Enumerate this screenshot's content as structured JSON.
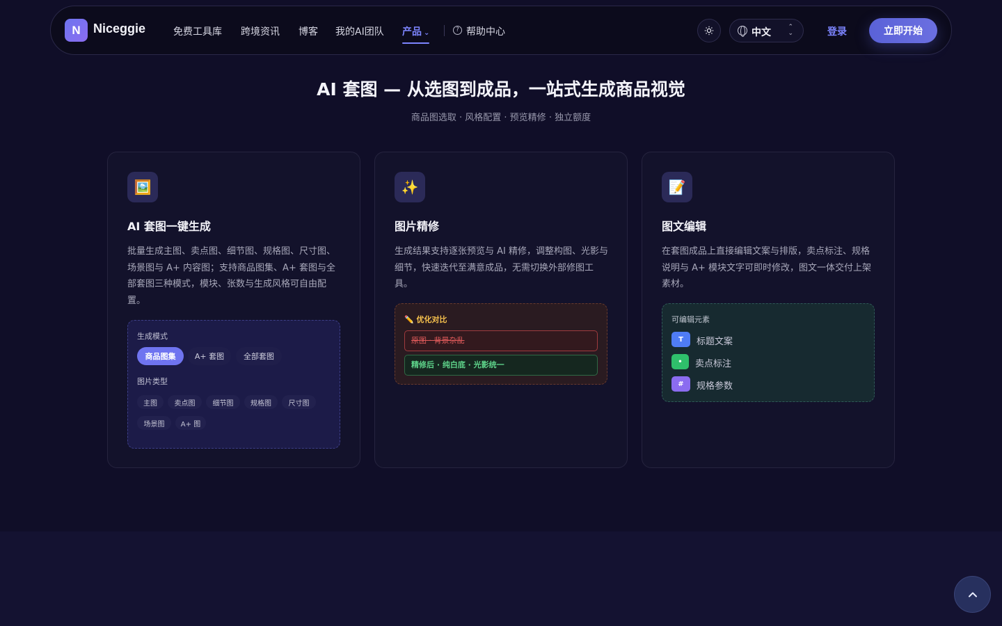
{
  "nav": {
    "logo_letter": "N",
    "brand": "Niceggie",
    "links": [
      "免费工具库",
      "跨境资讯",
      "博客",
      "我的AI团队"
    ],
    "products": "产品",
    "help": "帮助中心",
    "language": "中文",
    "login": "登录",
    "start": "立即开始",
    "accent": "#7d85ff"
  },
  "hero": {
    "title": "AI 套图 — 从选图到成品，一站式生成商品视觉",
    "subtitle": "商品图选取 · 风格配置 · 预览精修 · 独立额度"
  },
  "cards": [
    {
      "icon": "🖼️",
      "title": "AI 套图一键生成",
      "description": "批量生成主图、卖点图、细节图、规格图、尺寸图、场景图与 A+ 内容图；支持商品图集、A+ 套图与全部套图三种模式，模块、张数与生成风格可自由配置。",
      "mode_label": "生成模式",
      "modes": [
        "商品图集",
        "A+ 套图",
        "全部套图"
      ],
      "type_label": "图片类型",
      "types": [
        "主图",
        "卖点图",
        "细节图",
        "规格图",
        "尺寸图",
        "场景图",
        "A+ 图"
      ]
    },
    {
      "icon": "✨",
      "title": "图片精修",
      "description": "生成结果支持逐张预览与 AI 精修，调整构图、光影与细节，快速迭代至满意成品，无需切换外部修图工具。",
      "compare_title": "✏️ 优化对比",
      "before": "原图 · 背景杂乱",
      "after": "精修后 · 纯白底 · 光影统一"
    },
    {
      "icon": "📝",
      "title": "图文编辑",
      "description": "在套图成品上直接编辑文案与排版，卖点标注、规格说明与 A+ 模块文字可即时修改，图文一体交付上架素材。",
      "editable_title": "可编辑元素",
      "elements": [
        {
          "badge": "T",
          "label": "标题文案",
          "color": "#4f7cf5"
        },
        {
          "badge": "•",
          "label": "卖点标注",
          "color": "#2fbf6b"
        },
        {
          "badge": "#",
          "label": "规格参数",
          "color": "#8b6cf0"
        }
      ]
    }
  ]
}
